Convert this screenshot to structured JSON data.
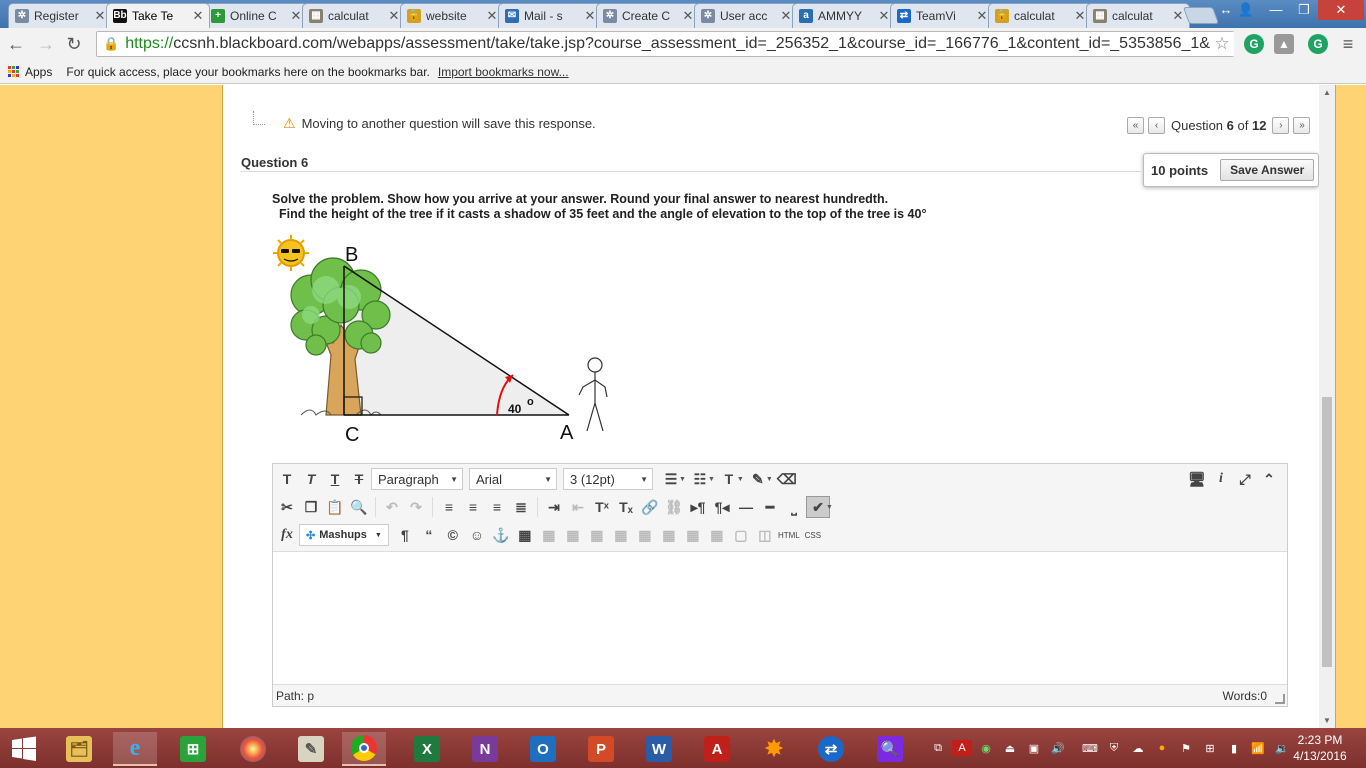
{
  "browser": {
    "tabs": [
      {
        "label": "Register",
        "icon": "gear-icon",
        "color": "#7a8aa0",
        "glyph": "✲"
      },
      {
        "label": "Take Te",
        "icon": "blackboard-icon",
        "color": "#111111",
        "glyph": "Bb",
        "active": true
      },
      {
        "label": "Online C",
        "icon": "plus-globe-icon",
        "color": "#2a9a3a",
        "glyph": "+"
      },
      {
        "label": "calculat",
        "icon": "calculator-icon",
        "color": "#8a8070",
        "glyph": "▦"
      },
      {
        "label": "website",
        "icon": "lock-icon",
        "color": "#d4a020",
        "glyph": "🔒"
      },
      {
        "label": "Mail - s",
        "icon": "mail-icon",
        "color": "#2f6db5",
        "glyph": "✉"
      },
      {
        "label": "Create C",
        "icon": "gear-icon",
        "color": "#7a8aa0",
        "glyph": "✲"
      },
      {
        "label": "User acc",
        "icon": "gear-icon",
        "color": "#7a8aa0",
        "glyph": "✲"
      },
      {
        "label": "AMMYY",
        "icon": "ammyy-icon",
        "color": "#2a6db0",
        "glyph": "a"
      },
      {
        "label": "TeamVi",
        "icon": "teamviewer-icon",
        "color": "#1a68c8",
        "glyph": "⇄"
      },
      {
        "label": "calculat",
        "icon": "lock-icon",
        "color": "#d4a020",
        "glyph": "🔒"
      },
      {
        "label": "calculat",
        "icon": "calculator-icon",
        "color": "#8a8070",
        "glyph": "▦"
      }
    ],
    "url_scheme": "https://",
    "url_rest": "ccsnh.blackboard.com/webapps/assessment/take/take.jsp?course_assessment_id=_256352_1&course_id=_166776_1&content_id=_5353856_1&ques",
    "bookmarks": {
      "apps": "Apps",
      "hint": "For quick access, place your bookmarks here on the bookmarks bar.",
      "import_link": "Import bookmarks now..."
    }
  },
  "assessment": {
    "warning": "Moving to another question will save this response.",
    "nav": {
      "prefix": "Question",
      "current": "6",
      "of": "of",
      "total": "12"
    },
    "question_title": "Question 6",
    "points": "10 points",
    "save_button": "Save Answer",
    "instruction": "Solve the problem.  Show how you arrive at your answer. Round your final answer to nearest hundredth.",
    "problem": "Find the height of the tree if it casts a shadow of 35 feet and the angle of elevation  to the top of the tree is 40°",
    "diagram": {
      "label_b": "B",
      "label_c": "C",
      "label_a": "A",
      "angle": "40",
      "degree_mark": "o"
    }
  },
  "editor": {
    "format_select": "Paragraph",
    "font_select": "Arial",
    "size_select": "3 (12pt)",
    "mashups": "Mashups",
    "html_label": "HTML",
    "css_label": "CSS",
    "path_label": "Path: p",
    "words_label": "Words:0"
  },
  "taskbar": {
    "time": "2:23 PM",
    "date": "4/13/2016"
  }
}
